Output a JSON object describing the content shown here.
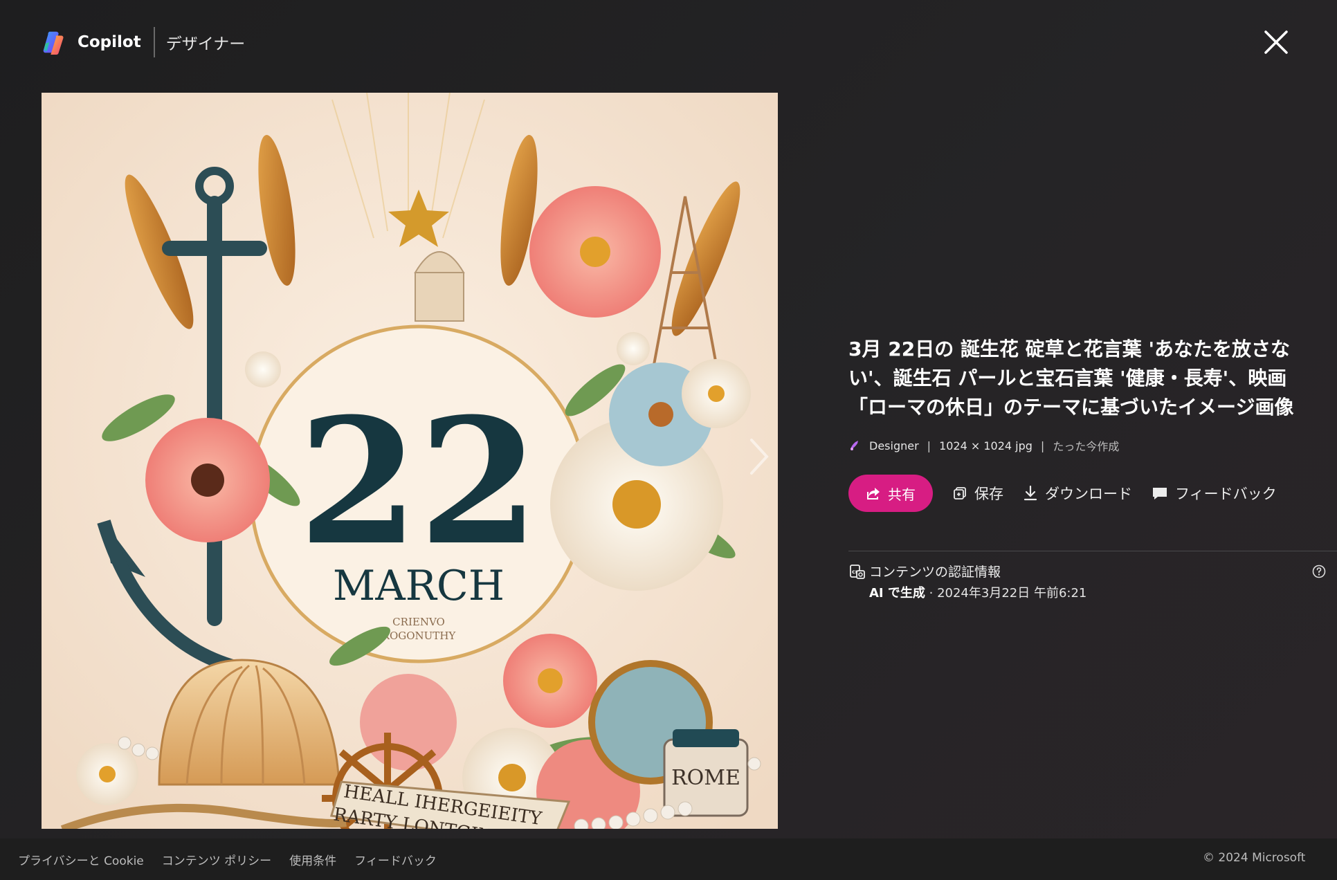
{
  "header": {
    "brand": "Copilot",
    "product": "デザイナー",
    "logo_icon": "copilot-logo-icon",
    "close_icon": "close-icon"
  },
  "image": {
    "number": "22",
    "month": "MARCH",
    "small_text_1": "CRIENVO",
    "small_text_2": "ROGONUTHY",
    "banner_line_1": "HEALL IHERGEIEITY",
    "banner_line_2": "RARTY LONTGINAITY",
    "jar_label": "ROME"
  },
  "info": {
    "title": "3月 22日の 誕生花 碇草と花言葉 'あなたを放さない'、誕生石 パールと宝石言葉 '健康・長寿'、映画「ローマの休日」のテーマに基づいたイメージ画像",
    "source": "Designer",
    "size": "1024 × 1024 jpg",
    "time": "たった今作成"
  },
  "actions": {
    "share": "共有",
    "save": "保存",
    "download": "ダウンロード",
    "feedback": "フィードバック"
  },
  "credentials": {
    "title": "コンテンツの認証情報",
    "ai_label": "AI で生成",
    "date": " · 2024年3月22日 午前6:21"
  },
  "footer": {
    "links": [
      "プライバシーと Cookie",
      "コンテンツ ポリシー",
      "使用条件",
      "フィードバック"
    ],
    "copyright": "© 2024 Microsoft"
  },
  "colors": {
    "background": "#232224",
    "share_button": "#d71d83",
    "footer": "#1e1e1e"
  }
}
